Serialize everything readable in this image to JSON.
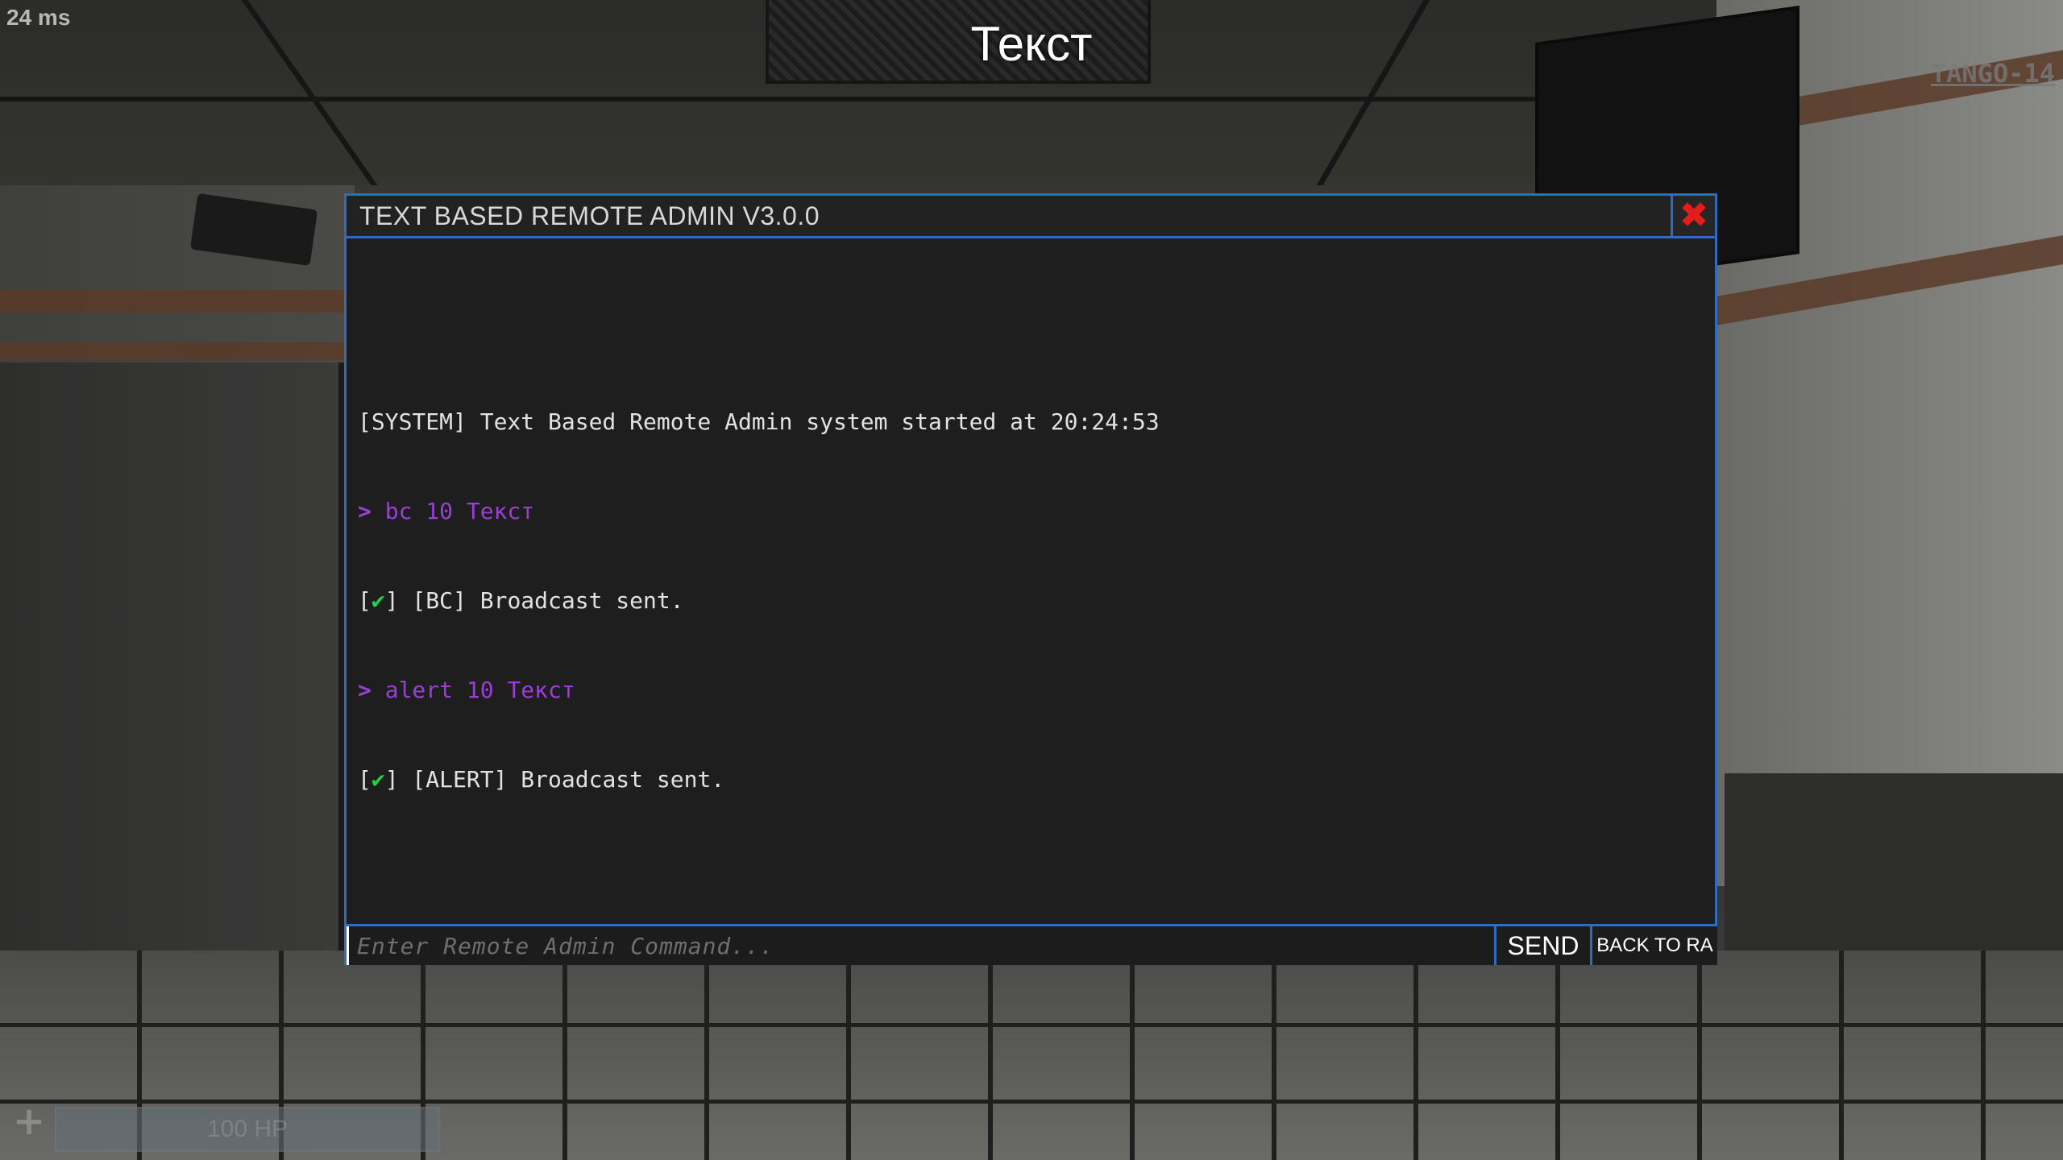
{
  "hud": {
    "ping": "24 ms",
    "broadcast": "Текст",
    "tag": "TANGO-14",
    "hp_text": "100 HP",
    "hp_fraction": 1.0
  },
  "ra_window": {
    "title": "TEXT BASED REMOTE ADMIN V3.0.0",
    "close_icon": "close-icon",
    "log": [
      {
        "type": "system",
        "text": "[SYSTEM] Text Based Remote Admin system started at 20:24:53"
      },
      {
        "type": "command",
        "prefix": ">",
        "text": "bc 10 Текст"
      },
      {
        "type": "result",
        "open": "[",
        "check": "✔",
        "close": "]",
        "text": " [BC] Broadcast sent."
      },
      {
        "type": "command",
        "prefix": ">",
        "text": "alert 10 Текст"
      },
      {
        "type": "result",
        "open": "[",
        "check": "✔",
        "close": "]",
        "text": " [ALERT] Broadcast sent."
      }
    ],
    "input": {
      "placeholder": "Enter Remote Admin Command...",
      "value": ""
    },
    "send_label": "SEND",
    "back_label": "BACK TO RA"
  },
  "colors": {
    "accent_border": "#2d6cc0",
    "command": "#9a3fd6",
    "success": "#23d14a",
    "close": "#e31c1c"
  }
}
